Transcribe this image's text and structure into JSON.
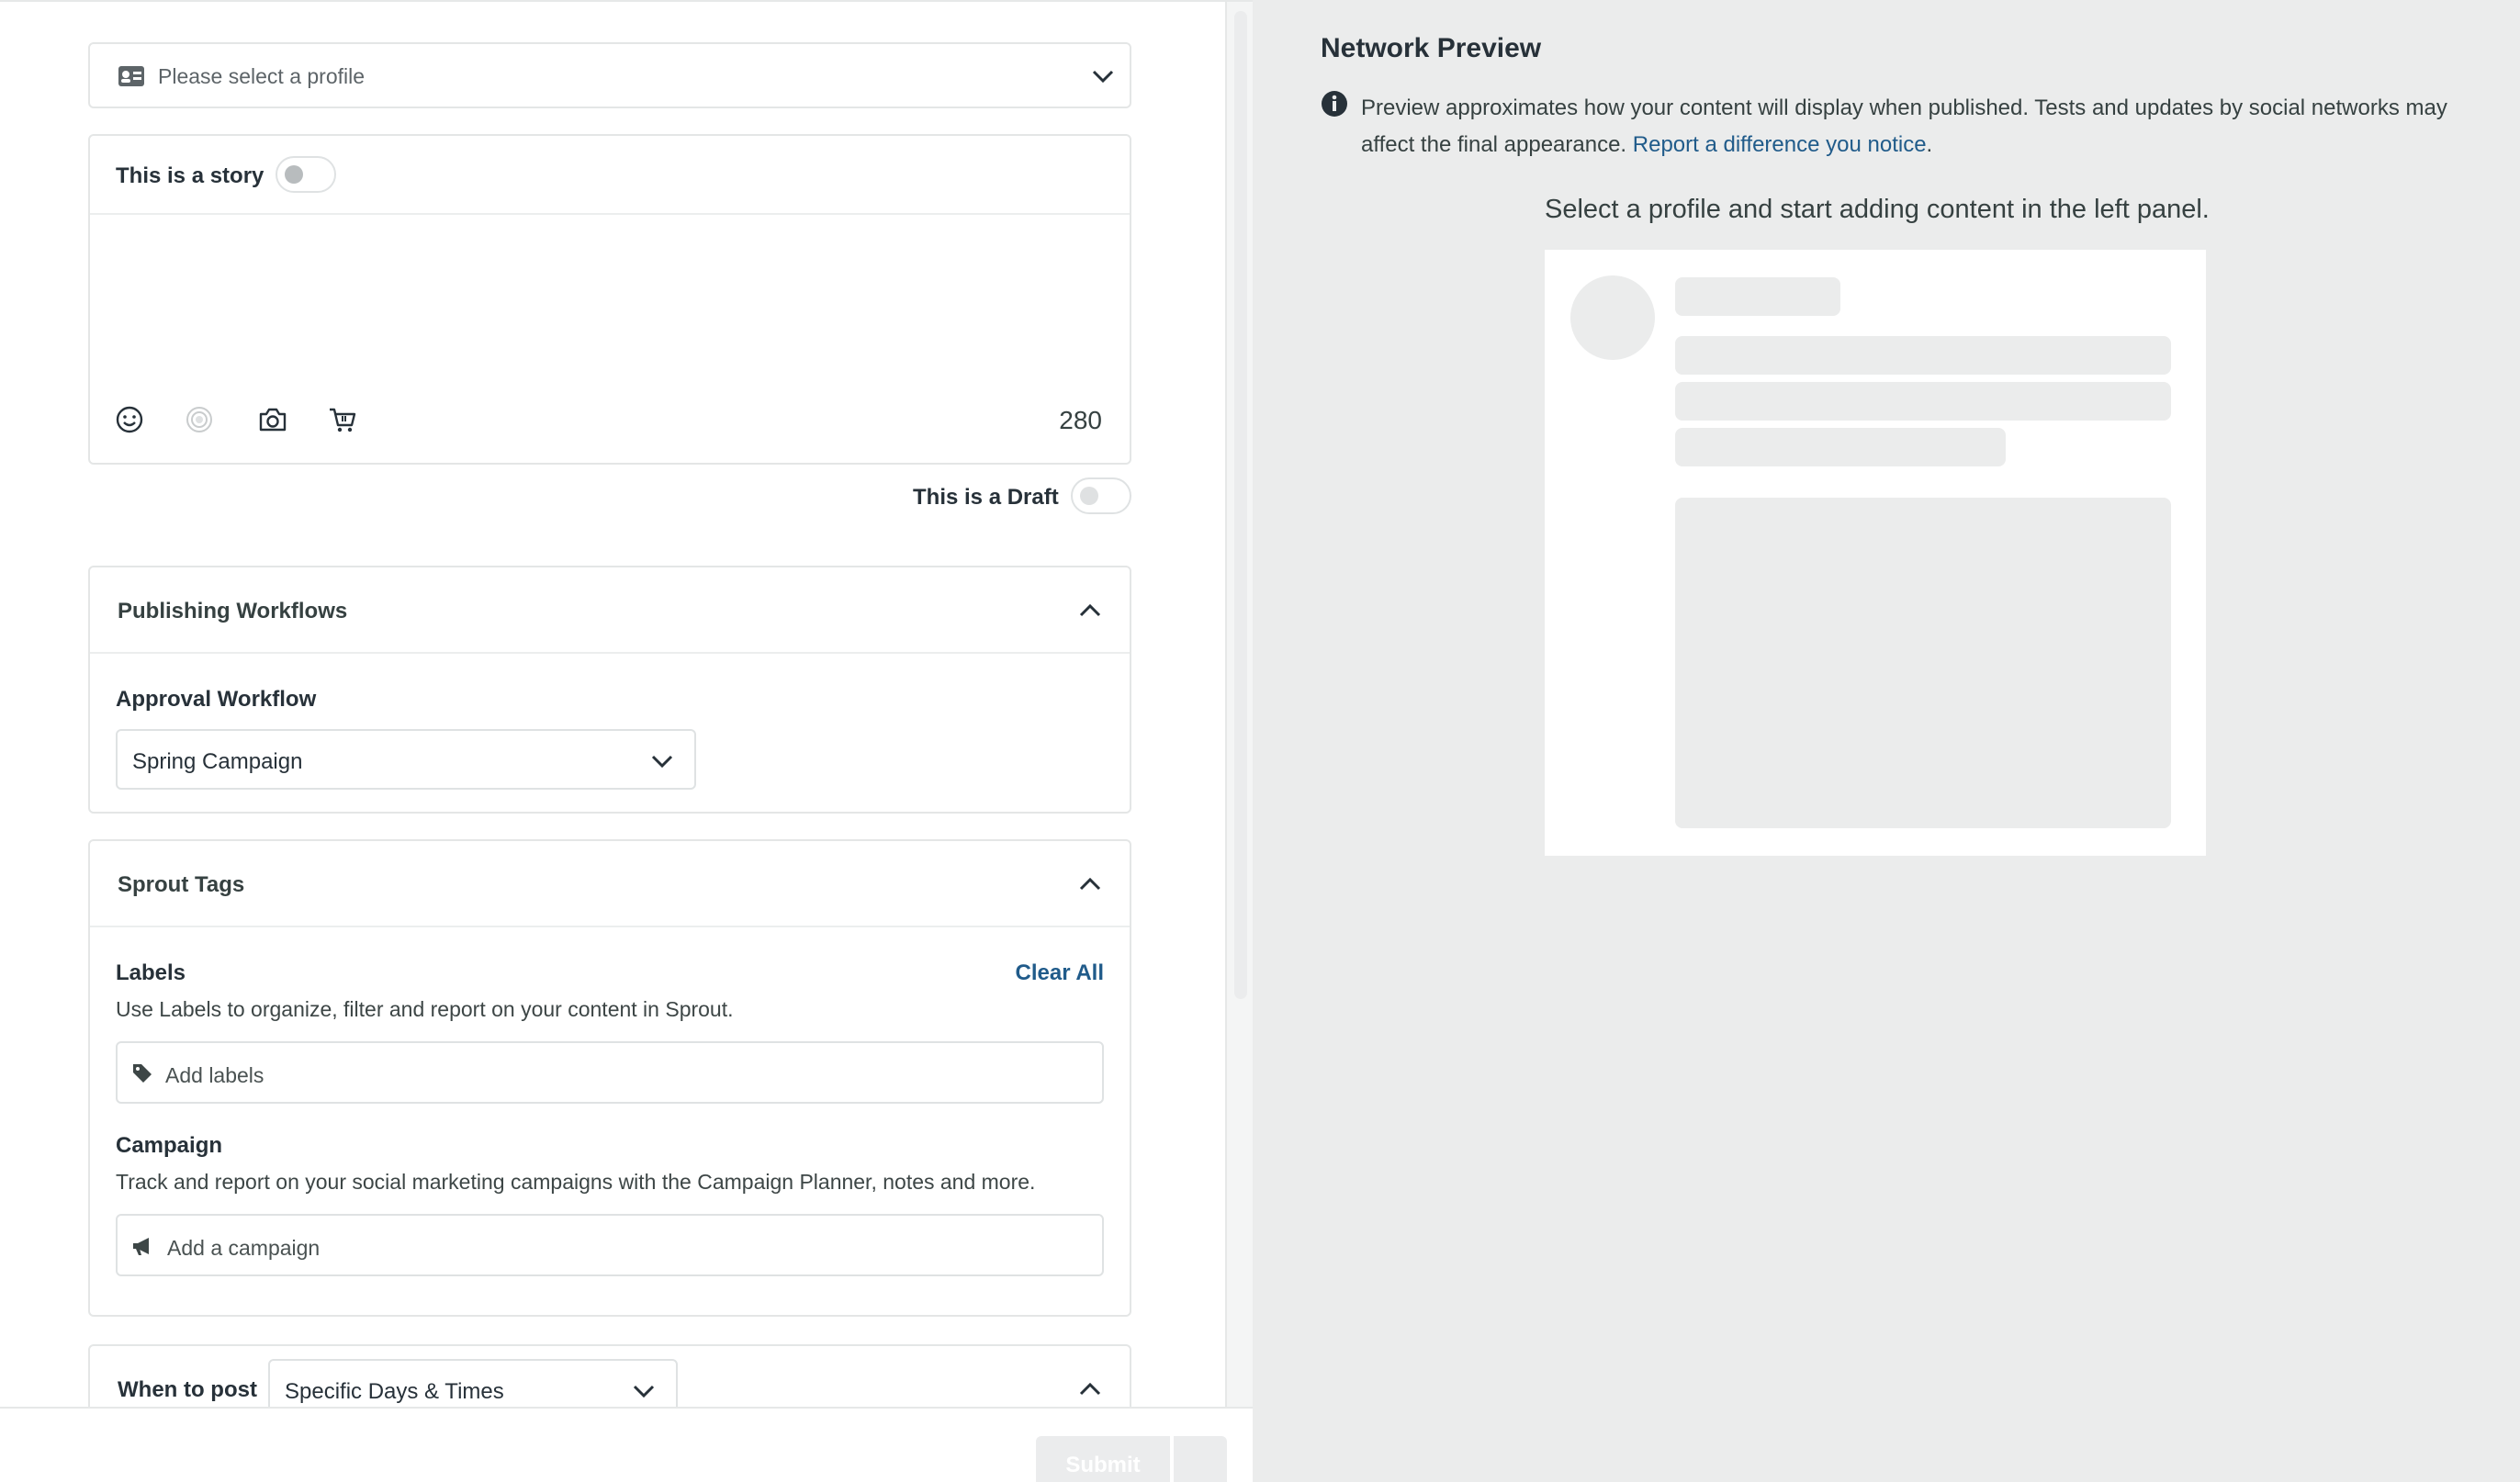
{
  "composer": {
    "profile_placeholder": "Please select a profile",
    "story_label": "This is a story",
    "character_count": "280",
    "draft_label": "This is a Draft",
    "toolbar_icons": [
      "emoji-icon",
      "mention-icon",
      "camera-icon",
      "cart-icon"
    ]
  },
  "workflows": {
    "title": "Publishing Workflows",
    "approval_label": "Approval Workflow",
    "approval_value": "Spring Campaign"
  },
  "tags": {
    "title": "Sprout Tags",
    "labels_title": "Labels",
    "clear_all": "Clear All",
    "labels_help": "Use Labels to organize, filter and report on your content in Sprout.",
    "labels_placeholder": "Add labels",
    "campaign_title": "Campaign",
    "campaign_help": "Track and report on your social marketing campaigns with the Campaign Planner, notes and more.",
    "campaign_placeholder": "Add a campaign"
  },
  "schedule": {
    "label": "When to post",
    "value": "Specific Days & Times"
  },
  "footer": {
    "submit_label": "Submit"
  },
  "preview": {
    "title": "Network Preview",
    "disclaimer": "Preview approximates how your content will display when published. Tests and updates by social networks may affect the final appearance.",
    "disclaimer_link": "Report a difference you notice",
    "disclaimer_end": ".",
    "instruction": "Select a profile and start adding content in the left panel."
  },
  "colors": {
    "link": "#205b8a",
    "preview_background": "#ebecec",
    "border": "#e4e6e6"
  }
}
